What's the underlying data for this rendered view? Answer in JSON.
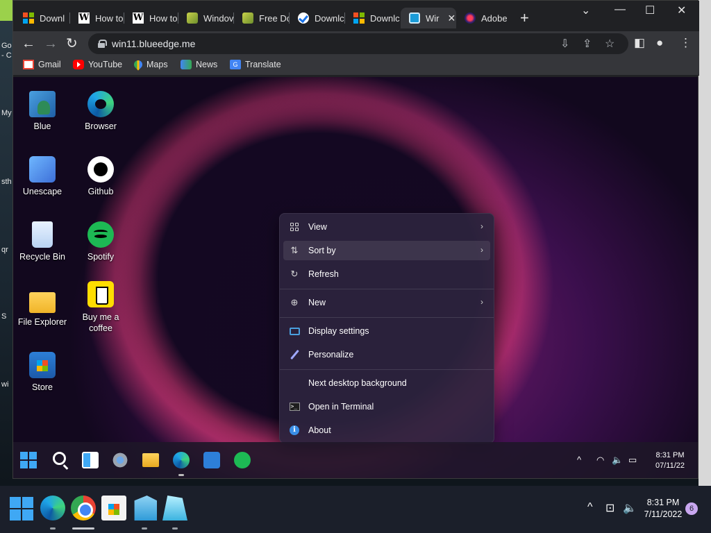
{
  "host_left_labels": [
    "Go",
    "- C",
    "My",
    "sth",
    "qr",
    "S",
    "wi"
  ],
  "tabs": [
    {
      "label": "Downl",
      "favicon": "microsoft-icon"
    },
    {
      "label": "How to",
      "favicon": "wikihow-icon"
    },
    {
      "label": "How to",
      "favicon": "wikihow-icon"
    },
    {
      "label": "Windov",
      "favicon": "leaf-icon"
    },
    {
      "label": "Free Dc",
      "favicon": "leaf-icon"
    },
    {
      "label": "Downlc",
      "favicon": "checkmark-icon"
    },
    {
      "label": "Downlc",
      "favicon": "microsoft-icon"
    },
    {
      "label": "Wir",
      "favicon": "win11-icon",
      "active": true
    },
    {
      "label": "Adobe",
      "favicon": "adobe-icon"
    }
  ],
  "window_controls": {
    "minimize": "⌄",
    "restore": "—",
    "maximize": "☐",
    "close": "✕",
    "new_tab": "+"
  },
  "toolbar": {
    "back": "←",
    "forward": "→",
    "reload": "↻",
    "url": "win11.blueedge.me"
  },
  "bookmarks": [
    {
      "label": "Gmail",
      "icon": "gmail-icon"
    },
    {
      "label": "YouTube",
      "icon": "youtube-icon"
    },
    {
      "label": "Maps",
      "icon": "maps-icon"
    },
    {
      "label": "News",
      "icon": "news-icon"
    },
    {
      "label": "Translate",
      "icon": "translate-icon"
    }
  ],
  "desktop_icons": [
    {
      "label": "Blue",
      "icon": "blue-user-icon"
    },
    {
      "label": "Browser",
      "icon": "edge-icon"
    },
    {
      "label": "Unescape",
      "icon": "unescape-icon"
    },
    {
      "label": "Github",
      "icon": "github-icon"
    },
    {
      "label": "Recycle Bin",
      "icon": "recycle-bin-icon"
    },
    {
      "label": "Spotify",
      "icon": "spotify-icon"
    },
    {
      "label": "File Explorer",
      "icon": "folder-icon"
    },
    {
      "label": "Buy me a coffee",
      "icon": "coffee-icon"
    },
    {
      "label": "Store",
      "icon": "store-icon"
    }
  ],
  "context_menu": {
    "items": [
      {
        "label": "View",
        "icon": "view-grid-icon",
        "submenu": true
      },
      {
        "label": "Sort by",
        "icon": "sort-icon",
        "submenu": true,
        "hovered": true
      },
      {
        "label": "Refresh",
        "icon": "refresh-icon",
        "submenu": false
      },
      {
        "label": "New",
        "icon": "new-icon",
        "submenu": true
      },
      {
        "label": "Display settings",
        "icon": "display-icon",
        "submenu": false
      },
      {
        "label": "Personalize",
        "icon": "pen-icon",
        "submenu": false
      },
      {
        "label": "Next desktop background",
        "icon": "",
        "submenu": false
      },
      {
        "label": "Open in Terminal",
        "icon": "terminal-icon",
        "submenu": false
      },
      {
        "label": "About",
        "icon": "info-icon",
        "submenu": false
      }
    ],
    "submenu_arrow": "›"
  },
  "virtual_taskbar": {
    "apps": [
      "start-icon",
      "search-icon",
      "widgets-icon",
      "settings-icon",
      "file-explorer-icon",
      "edge-icon",
      "store-icon",
      "spotify-icon"
    ],
    "tray": {
      "chevron": "^",
      "wifi": "◠",
      "volume": "🔈",
      "battery": "▭"
    },
    "time": "8:31 PM",
    "date": "07/11/22"
  },
  "host_taskbar": {
    "apps": [
      "start-icon",
      "edge-icon",
      "chrome-icon",
      "store-icon",
      "app-icon",
      "app-icon"
    ],
    "tray": {
      "chevron": "^",
      "network": "⊡",
      "volume": "🔈"
    },
    "time": "8:31 PM",
    "date": "7/11/2022",
    "notification_count": "6"
  },
  "colors": {
    "accent": "#3fa8f4",
    "chrome_bg": "#202124",
    "toolbar_bg": "#35363a",
    "menu_bg": "#2c243e"
  }
}
